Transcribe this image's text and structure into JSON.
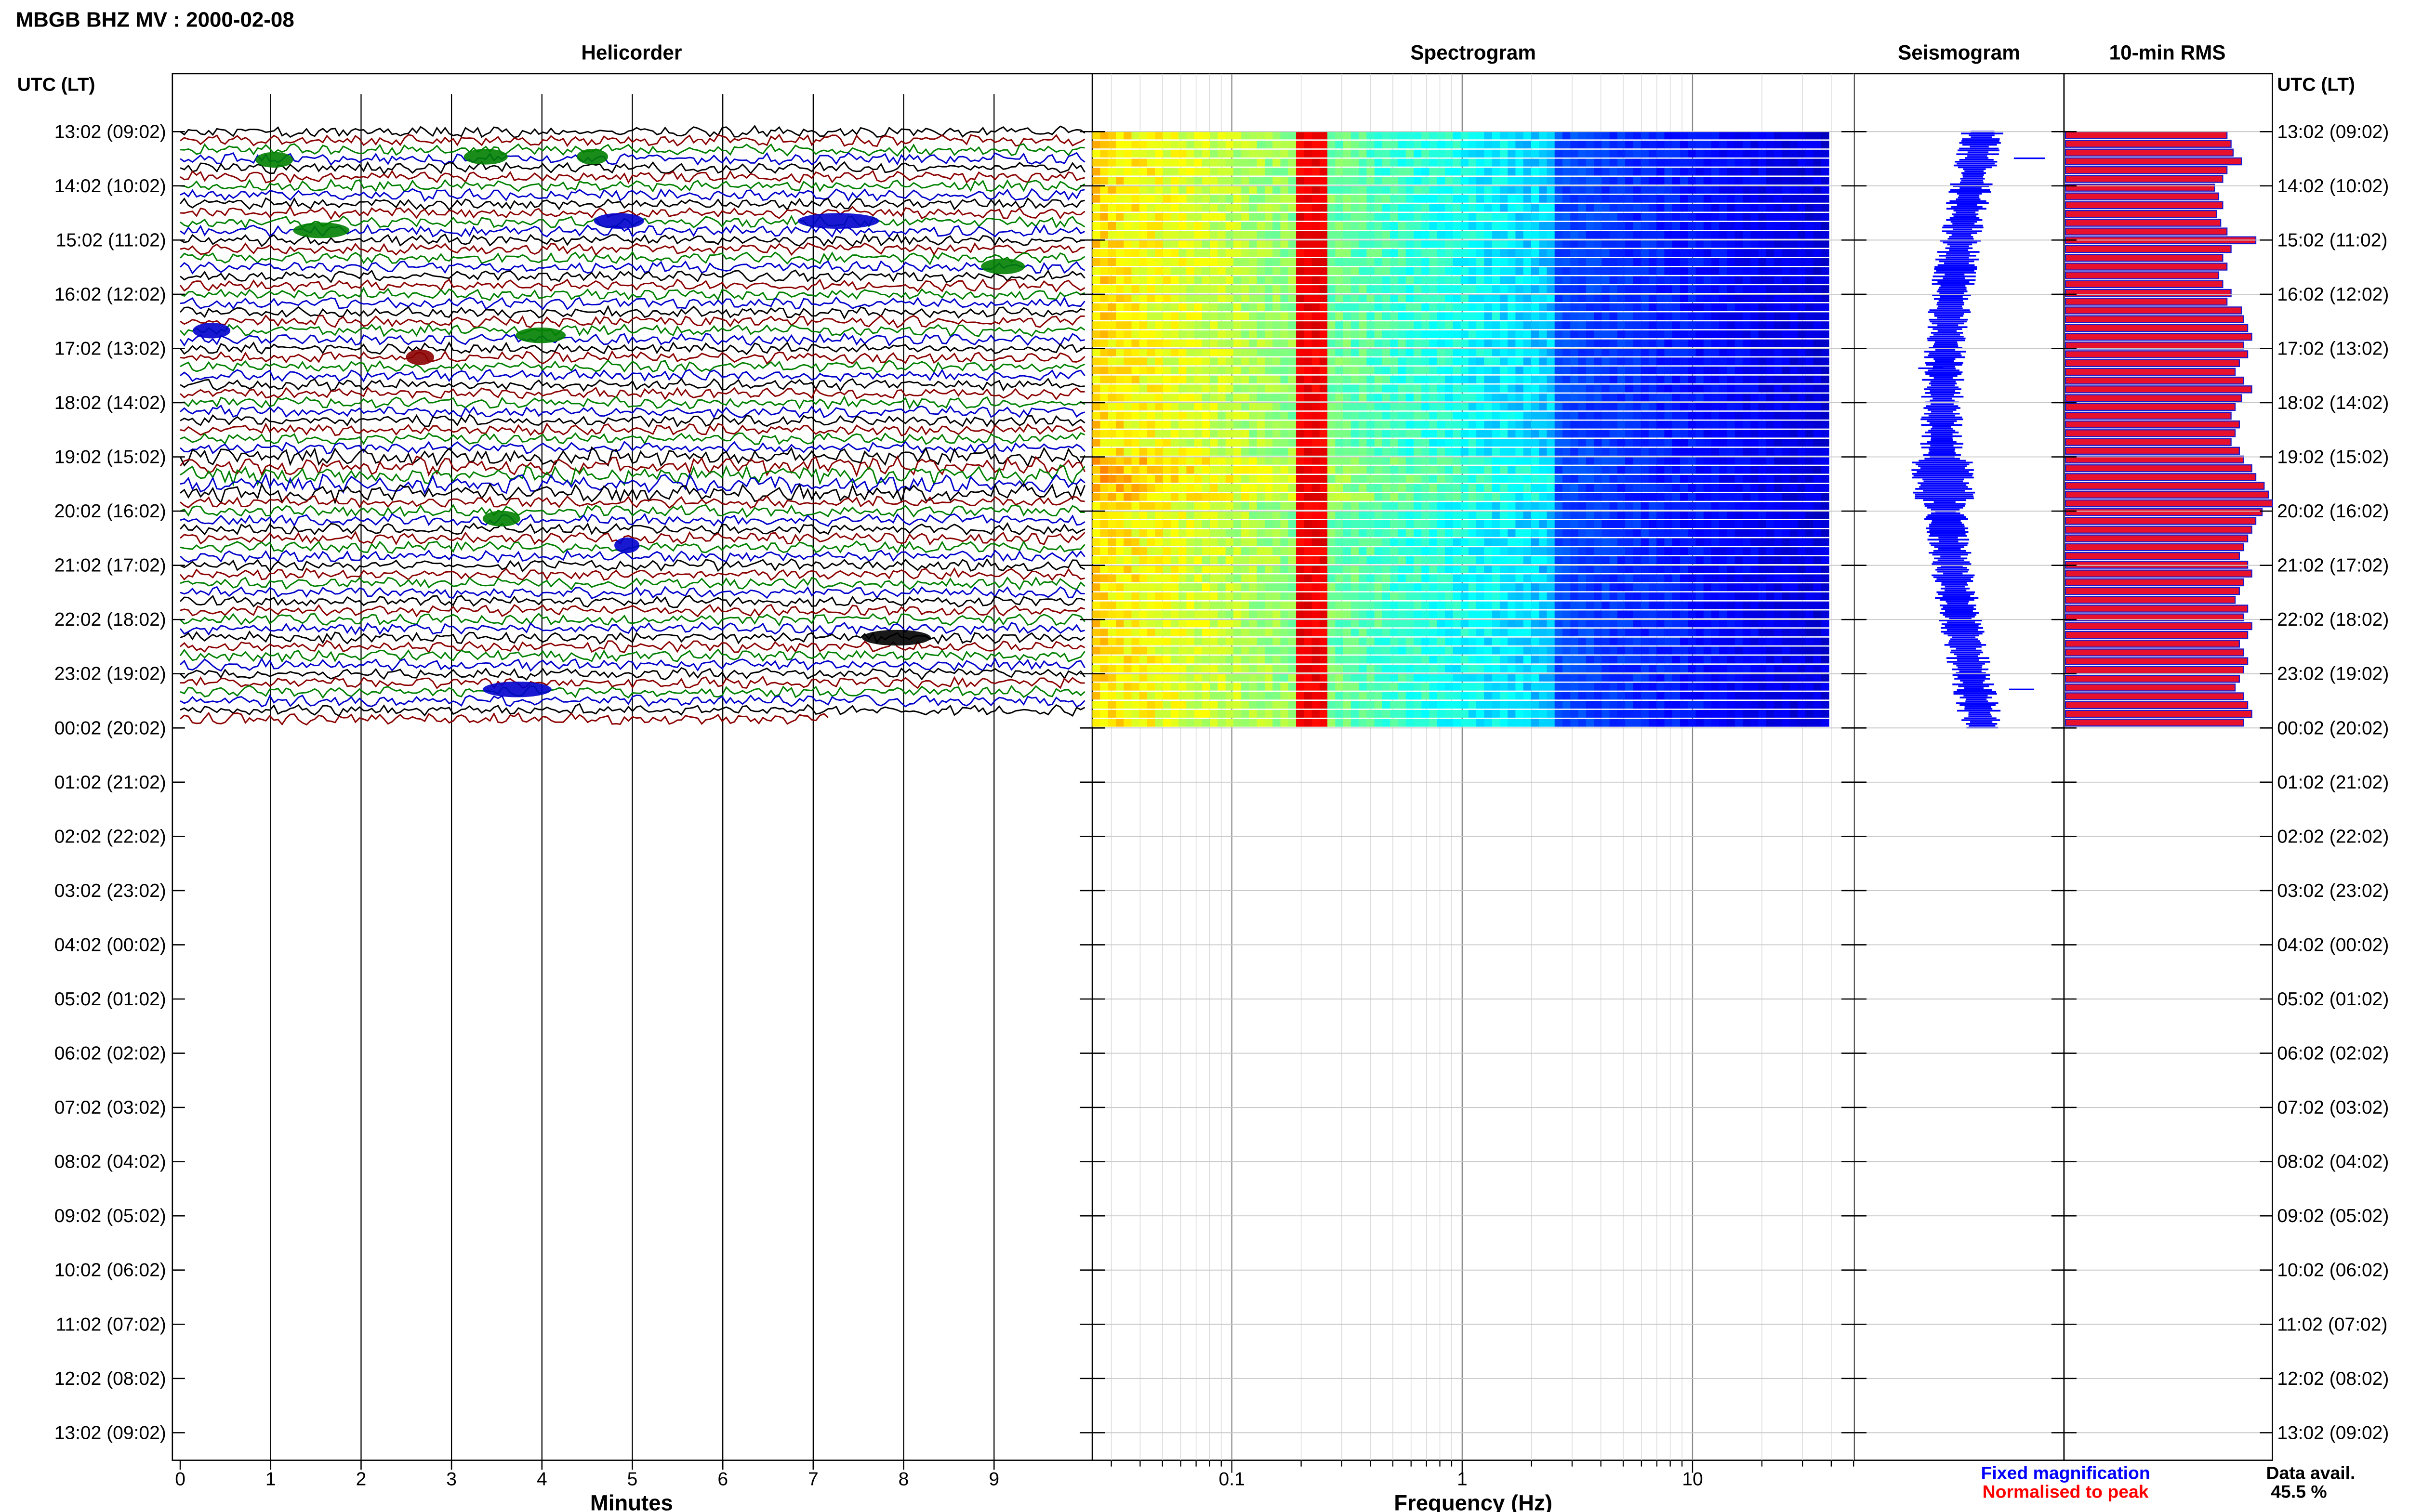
{
  "header": {
    "title": "MBGB BHZ MV : 2000-02-08"
  },
  "panels": {
    "helicorder": "Helicorder",
    "spectrogram": "Spectrogram",
    "seismogram": "Seismogram",
    "rms": "10-min RMS"
  },
  "time_axis_label": "UTC (LT)",
  "time_labels": [
    "13:02 (09:02)",
    "14:02 (10:02)",
    "15:02 (11:02)",
    "16:02 (12:02)",
    "17:02 (13:02)",
    "18:02 (14:02)",
    "19:02 (15:02)",
    "20:02 (16:02)",
    "21:02 (17:02)",
    "22:02 (18:02)",
    "23:02 (19:02)",
    "00:02 (20:02)",
    "01:02 (21:02)",
    "02:02 (22:02)",
    "03:02 (23:02)",
    "04:02 (00:02)",
    "05:02 (01:02)",
    "06:02 (02:02)",
    "07:02 (03:02)",
    "08:02 (04:02)",
    "09:02 (05:02)",
    "10:02 (06:02)",
    "11:02 (07:02)",
    "12:02 (08:02)",
    "13:02 (09:02)"
  ],
  "helicorder_axis": {
    "label": "Minutes",
    "ticks": [
      "0",
      "1",
      "2",
      "3",
      "4",
      "5",
      "6",
      "7",
      "8",
      "9"
    ]
  },
  "spectrogram_axis": {
    "label": "Frequency (Hz)",
    "ticks": [
      "0.1",
      "1",
      "10"
    ]
  },
  "legend": {
    "fixed": "Fixed magnification",
    "normalised": "Normalised to peak",
    "fixed_color": "#0000ff",
    "normalised_color": "#ff0000"
  },
  "availability": {
    "label": "Data avail.",
    "value": "45.5 %"
  },
  "colors": {
    "trace_cycle": [
      "#000000",
      "#8b0000",
      "#008000",
      "#0000cc"
    ],
    "rms_fill": "#e8112d",
    "rms_edge": "#1a1acc",
    "seismogram": "#0000ff"
  },
  "chart_data": {
    "type": "heatmap",
    "data_hours_shown": 11,
    "data_availability_percent": 45.5,
    "rms_relative": [
      0.78,
      0.8,
      0.81,
      0.85,
      0.78,
      0.76,
      0.72,
      0.74,
      0.76,
      0.73,
      0.75,
      0.78,
      0.92,
      0.8,
      0.76,
      0.78,
      0.74,
      0.76,
      0.8,
      0.78,
      0.85,
      0.86,
      0.88,
      0.9,
      0.86,
      0.88,
      0.84,
      0.82,
      0.86,
      0.9,
      0.85,
      0.82,
      0.8,
      0.84,
      0.82,
      0.8,
      0.84,
      0.86,
      0.9,
      0.92,
      0.96,
      0.98,
      1.0,
      0.95,
      0.92,
      0.9,
      0.88,
      0.86,
      0.84,
      0.88,
      0.9,
      0.86,
      0.84,
      0.82,
      0.88,
      0.86,
      0.9,
      0.88,
      0.84,
      0.86,
      0.88,
      0.86,
      0.84,
      0.82,
      0.86,
      0.88,
      0.9,
      0.86
    ]
  }
}
